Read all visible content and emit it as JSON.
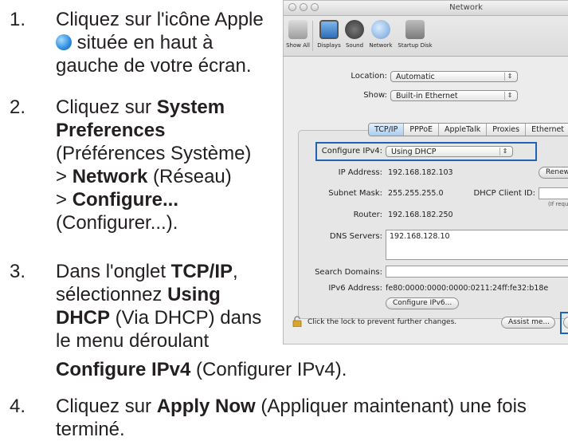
{
  "instructions": {
    "step1": {
      "num": "1.",
      "line1": "Cliquez sur l'icône Apple",
      "line2": " située en haut à",
      "line3": "gauche de votre écran."
    },
    "step2": {
      "num": "2.",
      "cliquez": "Cliquez sur ",
      "sp": "System",
      "sp2": "Preferences",
      "sp_fr": "(Préférences Système)",
      "net_pre": "> ",
      "net": "Network",
      "net_fr": " (Réseau)",
      "cfg_pre": "> ",
      "cfg": "Configure...",
      "cfg_fr": "(Configurer...)."
    },
    "step3": {
      "num": "3.",
      "l1a": "Dans l'onglet ",
      "tcp": "TCP/IP",
      "l1b": ",",
      "l2a": "sélectionnez ",
      "using": "Using",
      "dhcp": "DHCP",
      "l3b": " (Via DHCP) dans",
      "l4": "le menu déroulant",
      "cfg4": "Configure IPv4",
      "cfg4_fr": " (Configurer IPv4)."
    },
    "step4": {
      "num": "4.",
      "a": "Cliquez sur ",
      "apply": "Apply Now",
      "b": " (Appliquer maintenant) une fois",
      "c": "terminé."
    }
  },
  "window": {
    "title": "Network",
    "toolbar": {
      "show_all": "Show All",
      "displays": "Displays",
      "sound": "Sound",
      "network": "Network",
      "startup": "Startup Disk"
    },
    "location_label": "Location:",
    "location_value": "Automatic",
    "show_label": "Show:",
    "show_value": "Built-in Ethernet",
    "tabs": [
      "TCP/IP",
      "PPPoE",
      "AppleTalk",
      "Proxies",
      "Ethernet"
    ],
    "configure_label": "Configure IPv4:",
    "configure_value": "Using DHCP",
    "ip_label": "IP Address:",
    "ip_value": "192.168.182.103",
    "renew": "Renew D",
    "subnet_label": "Subnet Mask:",
    "subnet_value": "255.255.255.0",
    "client_label": "DHCP Client ID:",
    "client_hint": "(If requi",
    "router_label": "Router:",
    "router_value": "192.168.182.250",
    "dns_label": "DNS Servers:",
    "dns_value": "192.168.128.10",
    "search_label": "Search Domains:",
    "ipv6_label": "IPv6 Address:",
    "ipv6_value": "fe80:0000:0000:0000:0211:24ff:fe32:b18e",
    "configure_ipv6": "Configure IPv6...",
    "lock_text": "Click the lock to prevent further changes.",
    "assist": "Assist me..."
  }
}
